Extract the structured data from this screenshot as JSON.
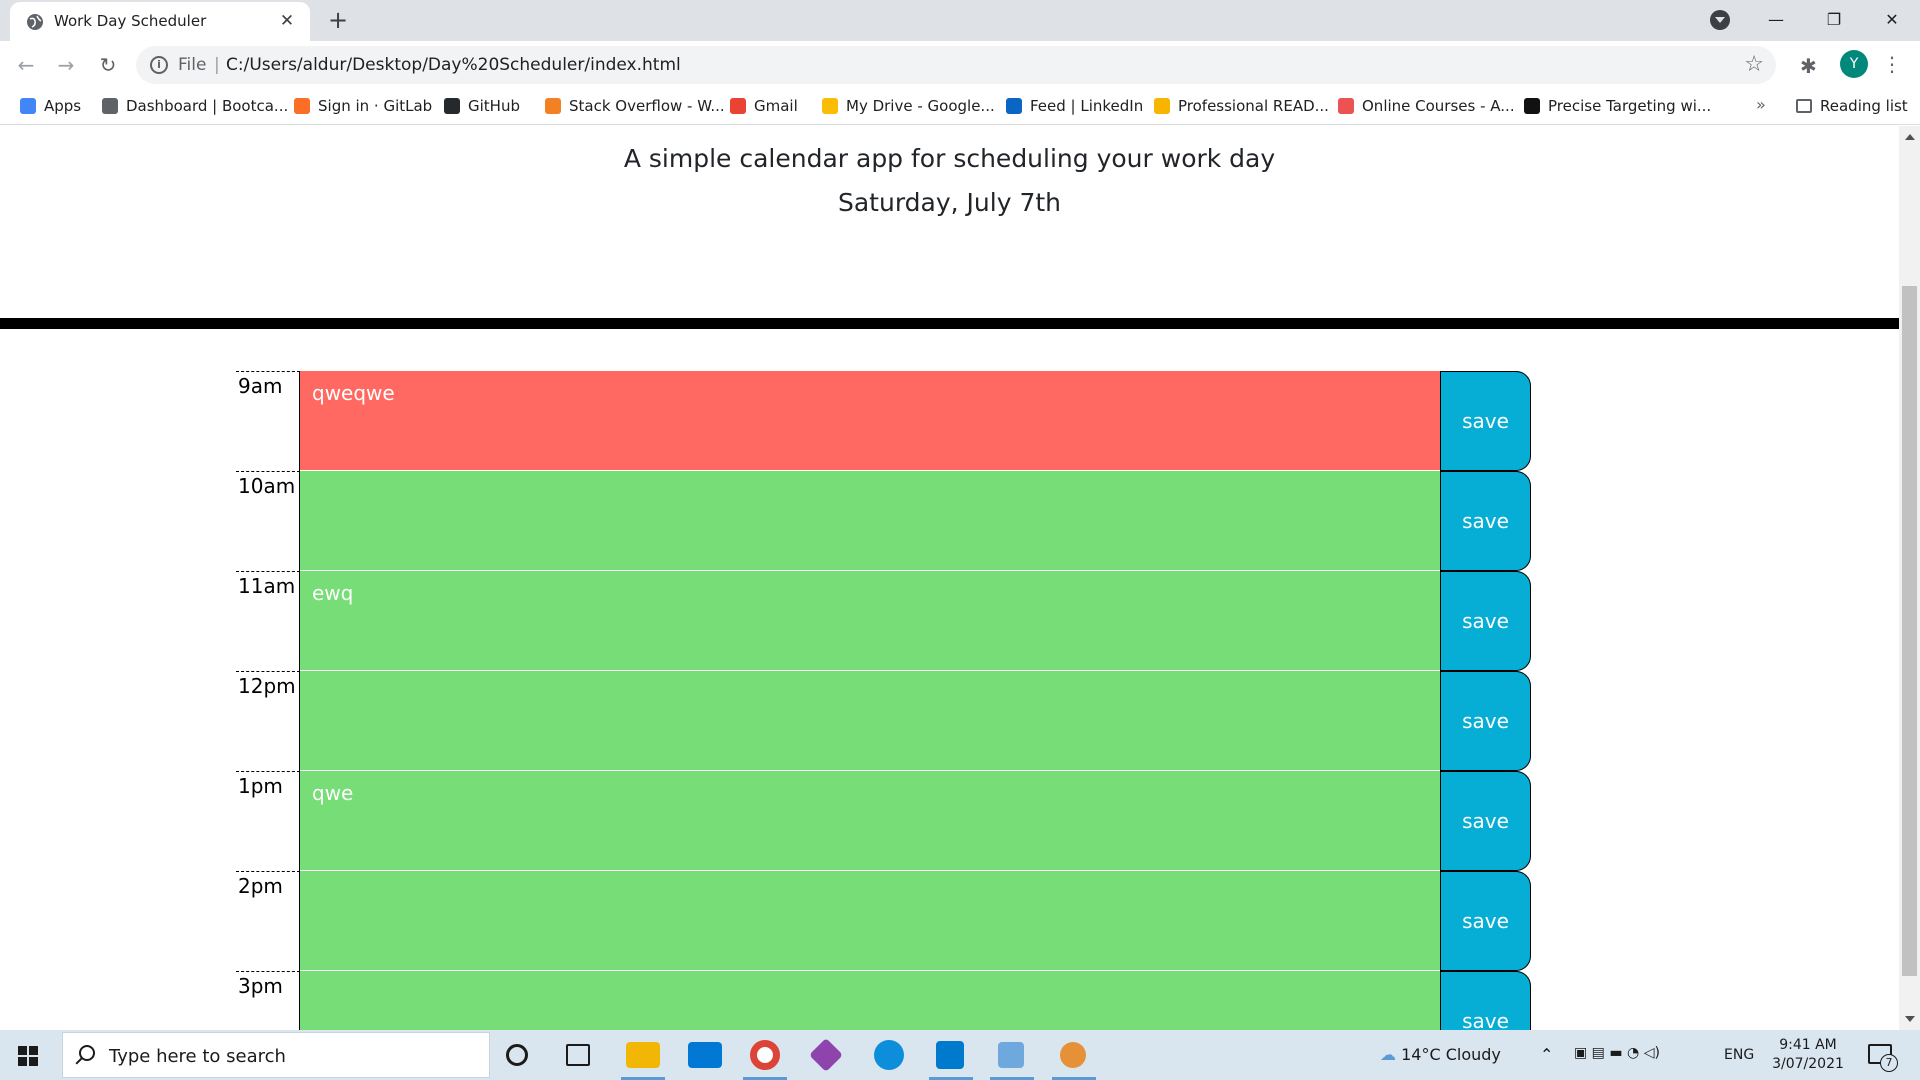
{
  "browser": {
    "tab_title": "Work Day Scheduler",
    "tab_close": "✕",
    "new_tab": "+",
    "url_scheme": "File",
    "url_separator": "|",
    "url": "C:/Users/aldur/Desktop/Day%20Scheduler/index.html",
    "profile_initial": "Y",
    "window_controls": {
      "minimize": "—",
      "restore": "❐",
      "close": "✕"
    }
  },
  "bookmarks": {
    "items": [
      {
        "label": "Apps",
        "color": "#4285f4"
      },
      {
        "label": "Dashboard | Bootca...",
        "color": "#5f6368"
      },
      {
        "label": "Sign in · GitLab",
        "color": "#fc6d26"
      },
      {
        "label": "GitHub",
        "color": "#24292e"
      },
      {
        "label": "Stack Overflow - W...",
        "color": "#f48024"
      },
      {
        "label": "Gmail",
        "color": "#ea4335"
      },
      {
        "label": "My Drive - Google...",
        "color": "#fbbc04"
      },
      {
        "label": "Feed | LinkedIn",
        "color": "#0a66c2"
      },
      {
        "label": "Professional READ...",
        "color": "#f7b500"
      },
      {
        "label": "Online Courses - A...",
        "color": "#ec5252"
      },
      {
        "label": "Precise Targeting wi...",
        "color": "#111111"
      }
    ],
    "more": "»",
    "reading_list": "Reading list"
  },
  "page": {
    "lead": "A simple calendar app for scheduling your work day",
    "current_day": "Saturday, July 7th",
    "colors": {
      "present": "#ff6961",
      "future": "#77dd77",
      "save": "#06aed5"
    },
    "hours": [
      {
        "label": "9am",
        "text": "qweqwe",
        "status": "present",
        "save": "save"
      },
      {
        "label": "10am",
        "text": "",
        "status": "future",
        "save": "save"
      },
      {
        "label": "11am",
        "text": "ewq",
        "status": "future",
        "save": "save"
      },
      {
        "label": "12pm",
        "text": "",
        "status": "future",
        "save": "save"
      },
      {
        "label": "1pm",
        "text": "qwe",
        "status": "future",
        "save": "save"
      },
      {
        "label": "2pm",
        "text": "",
        "status": "future",
        "save": "save"
      },
      {
        "label": "3pm",
        "text": "",
        "status": "future",
        "save": "save"
      }
    ]
  },
  "taskbar": {
    "search_placeholder": "Type here to search",
    "weather": "14°C  Cloudy",
    "language": "ENG",
    "time": "9:41 AM",
    "date": "3/07/2021",
    "notification_count": "7",
    "apps": [
      {
        "name": "cortana-icon",
        "color": "#1b1b1b"
      },
      {
        "name": "task-view-icon",
        "color": "#1b1b1b"
      },
      {
        "name": "file-explorer-icon",
        "color": "#f2b705"
      },
      {
        "name": "mail-icon",
        "color": "#0078d4"
      },
      {
        "name": "chrome-icon",
        "color": "#db4437"
      },
      {
        "name": "gitkraken-icon",
        "color": "#8e44ad"
      },
      {
        "name": "edge-icon",
        "color": "#0c8edb"
      },
      {
        "name": "vscode-icon",
        "color": "#007acc"
      },
      {
        "name": "app-icon",
        "color": "#6fa8dc"
      },
      {
        "name": "paint-icon",
        "color": "#e69138"
      }
    ]
  }
}
